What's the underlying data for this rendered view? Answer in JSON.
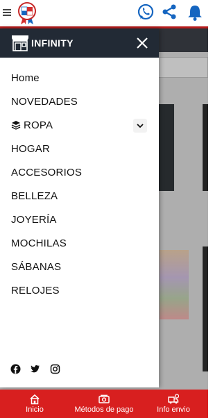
{
  "drawer": {
    "title": "INFINITY",
    "menu": [
      {
        "label": "Home"
      },
      {
        "label": "NOVEDADES"
      },
      {
        "label": "ROPA"
      },
      {
        "label": "HOGAR"
      },
      {
        "label": "ACCESORIOS"
      },
      {
        "label": "BELLEZA"
      },
      {
        "label": "JOYERÍA"
      },
      {
        "label": "MOCHILAS"
      },
      {
        "label": "SÁBANAS"
      },
      {
        "label": "RELOJES"
      }
    ],
    "social": [
      "facebook-icon",
      "twitter-icon",
      "instagram-icon"
    ]
  },
  "bottom_nav": {
    "items": [
      {
        "label": "Inicio"
      },
      {
        "label": "Métodos de pago"
      },
      {
        "label": "Info envio"
      }
    ]
  },
  "colors": {
    "header_dark": "#222a35",
    "accent_red": "#d81f1f",
    "whatsapp_blue": "#1565c0"
  }
}
